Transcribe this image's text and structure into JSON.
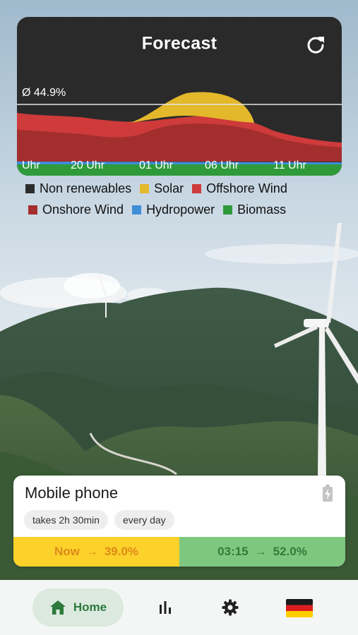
{
  "forecast": {
    "title": "Forecast",
    "average_label": "Ø 44.9%",
    "time_labels": [
      "Uhr",
      "20 Uhr",
      "01 Uhr",
      "06 Uhr",
      "11 Uhr"
    ]
  },
  "legend": {
    "items": [
      {
        "label": "Non renewables",
        "color": "#2b2b2b"
      },
      {
        "label": "Solar",
        "color": "#e3b82b"
      },
      {
        "label": "Offshore Wind",
        "color": "#cf3a3a"
      },
      {
        "label": "Onshore Wind",
        "color": "#a32e2e"
      },
      {
        "label": "Hydropower",
        "color": "#3f8ed8"
      },
      {
        "label": "Biomass",
        "color": "#2f9a3a"
      }
    ]
  },
  "device": {
    "title": "Mobile phone",
    "duration_chip": "takes 2h 30min",
    "repeat_chip": "every day",
    "now_label": "Now",
    "now_value": "39.0%",
    "best_time": "03:15",
    "best_value": "52.0%",
    "arrow": "→"
  },
  "nav": {
    "home_label": "Home"
  },
  "colors": {
    "card_bg": "#2a2a2a",
    "now_bg": "#fcd12a",
    "best_bg": "#7ec77f",
    "nav_active_bg": "#dbe9df",
    "nav_active_text": "#2b7a3b"
  }
}
